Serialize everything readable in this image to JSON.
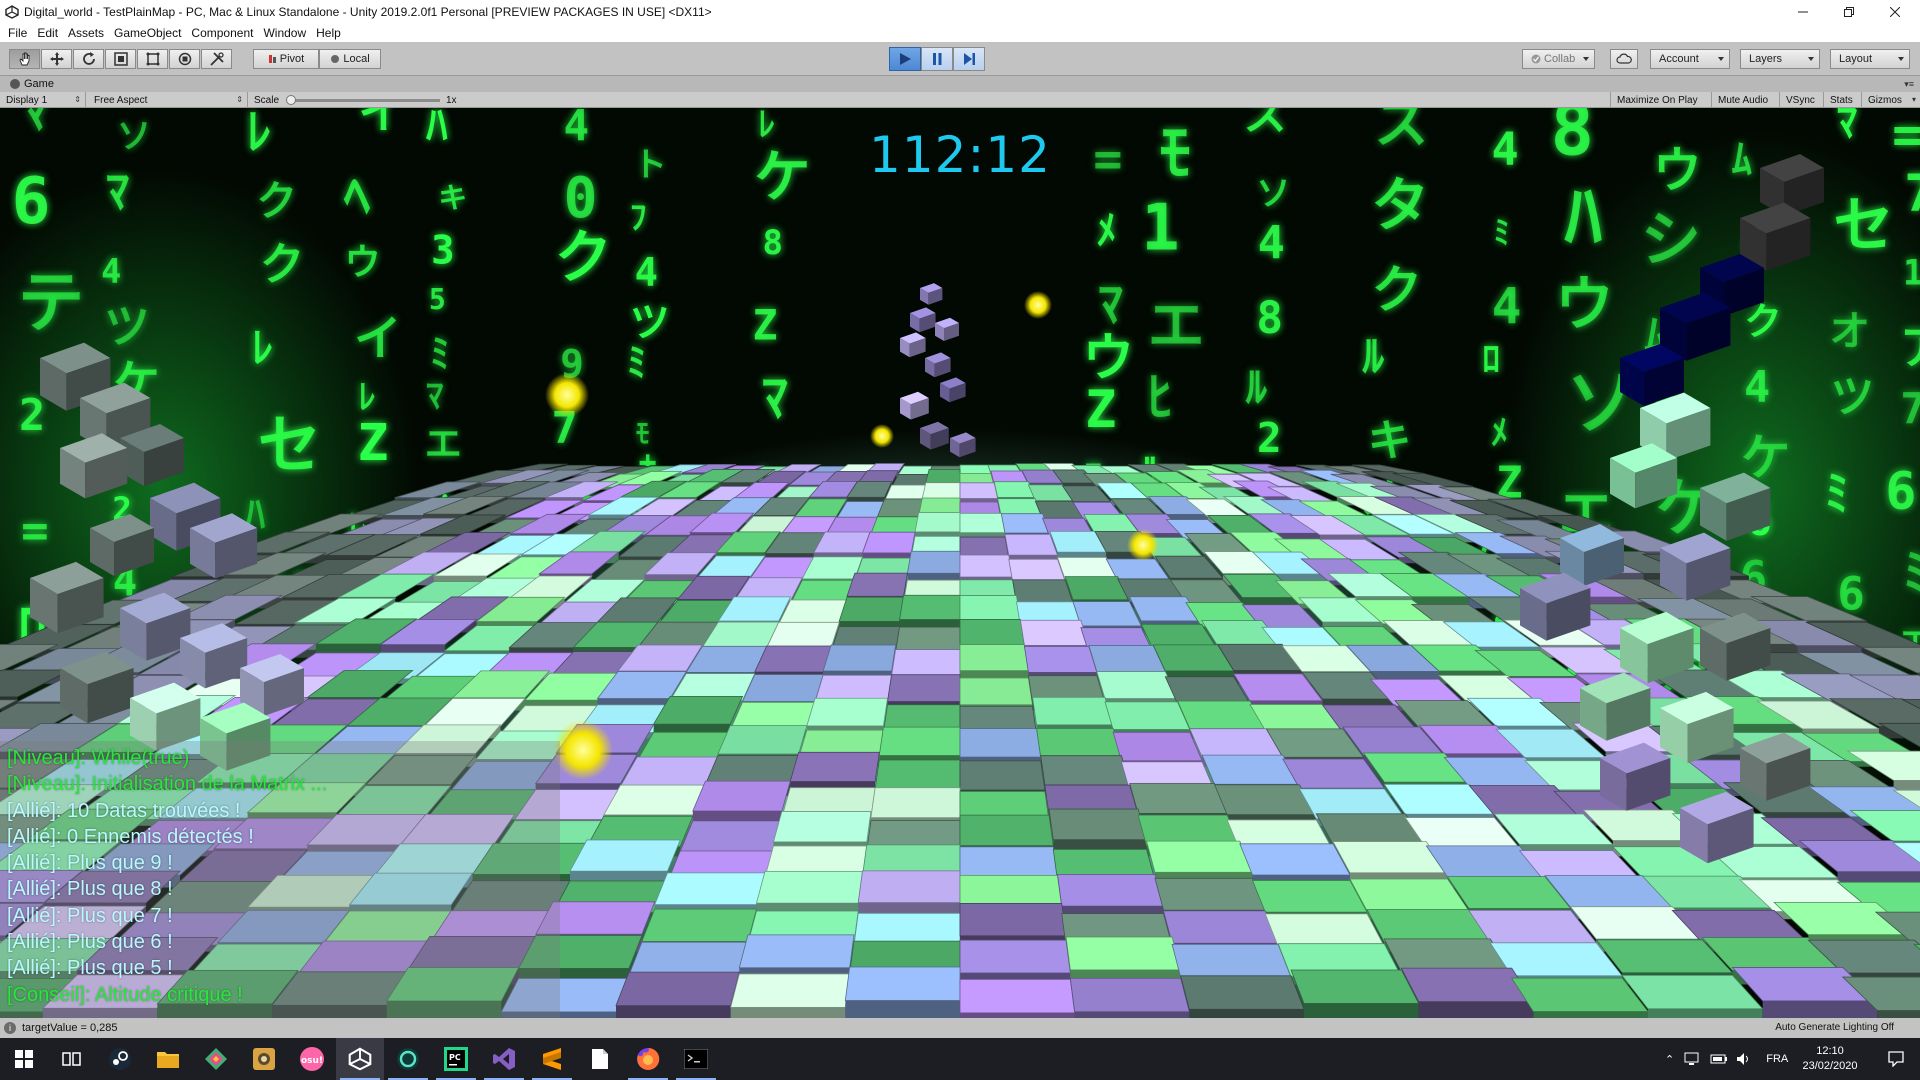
{
  "window": {
    "title": "Digital_world - TestPlainMap - PC, Mac & Linux Standalone - Unity 2019.2.0f1 Personal [PREVIEW PACKAGES IN USE] <DX11>"
  },
  "menu": [
    "File",
    "Edit",
    "Assets",
    "GameObject",
    "Component",
    "Window",
    "Help"
  ],
  "toolbar": {
    "tools": [
      "hand-tool-icon",
      "move-tool-icon",
      "rotate-tool-icon",
      "scale-tool-icon",
      "rect-tool-icon",
      "transform-tool-icon",
      "custom-tool-icon"
    ],
    "pivot_label": "Pivot",
    "local_label": "Local",
    "collab_label": "Collab",
    "account_label": "Account",
    "layers_label": "Layers",
    "layout_label": "Layout",
    "play_state": "playing"
  },
  "game_view": {
    "tab_label": "Game",
    "display_label": "Display 1",
    "aspect_label": "Free Aspect",
    "scale_label": "Scale",
    "scale_value": "1x",
    "toggles": [
      "Maximize On Play",
      "Mute Audio",
      "VSync",
      "Stats",
      "Gizmos"
    ]
  },
  "hud": {
    "timer": "112:12",
    "log": [
      {
        "text": "[Niveau]: While(true)",
        "color": "green"
      },
      {
        "text": "[Niveau]: Initialisation de la Matrix ...",
        "color": "green"
      },
      {
        "text": "[Allié]: 10 Datas trouvées !",
        "color": "cyan"
      },
      {
        "text": "[Allié]: 0 Ennemis détectés !",
        "color": "cyan"
      },
      {
        "text": "[Allié]: Plus que 9 !",
        "color": "cyan"
      },
      {
        "text": "[Allié]: Plus que 8 !",
        "color": "cyan"
      },
      {
        "text": "[Allié]: Plus que 7 !",
        "color": "cyan"
      },
      {
        "text": "[Allié]: Plus que 6 !",
        "color": "cyan"
      },
      {
        "text": "[Allié]: Plus que 5 !",
        "color": "cyan"
      },
      {
        "text": "[Conseil]: Altitude critique !",
        "color": "green"
      }
    ]
  },
  "status": {
    "message": "targetValue = 0,285",
    "lighting": "Auto Generate Lighting Off"
  },
  "taskbar": {
    "apps": [
      "start-icon",
      "task-view-icon",
      "steam-icon",
      "file-explorer-icon",
      "gitkraken-icon",
      "photo-icon",
      "osu-icon",
      "unity-icon",
      "gamemaker-icon",
      "pycharm-icon",
      "visual-studio-icon",
      "sublime-icon",
      "notepad-icon",
      "firefox-icon",
      "terminal-icon"
    ],
    "language": "FRA",
    "time": "12:10",
    "date": "23/02/2020"
  },
  "colors": {
    "matrix_green": "#22ff44",
    "timer_cyan": "#1ec8ee",
    "play_blue": "#4d88d4"
  }
}
